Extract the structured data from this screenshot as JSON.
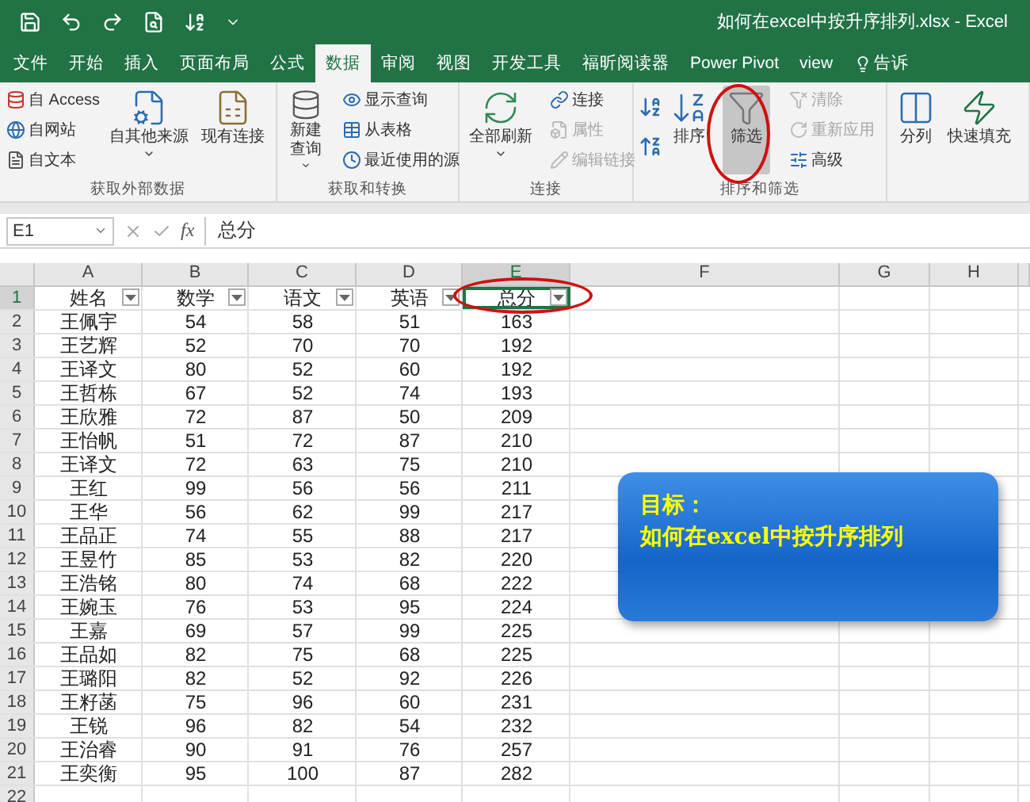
{
  "title_bar": {
    "title": "如何在excel中按升序排列.xlsx  -  Excel"
  },
  "tabs": [
    {
      "label": "文件",
      "selected": false
    },
    {
      "label": "开始",
      "selected": false
    },
    {
      "label": "插入",
      "selected": false
    },
    {
      "label": "页面布局",
      "selected": false
    },
    {
      "label": "公式",
      "selected": false
    },
    {
      "label": "数据",
      "selected": true
    },
    {
      "label": "审阅",
      "selected": false
    },
    {
      "label": "视图",
      "selected": false
    },
    {
      "label": "开发工具",
      "selected": false
    },
    {
      "label": "福昕阅读器",
      "selected": false
    },
    {
      "label": "Power Pivot",
      "selected": false
    },
    {
      "label": "view",
      "selected": false
    },
    {
      "label": "告诉",
      "selected": false
    }
  ],
  "ribbon": {
    "groups": [
      {
        "label": "获取外部数据",
        "items": [
          {
            "kind": "stack",
            "items": [
              {
                "label": "自 Access",
                "disabled": false
              },
              {
                "label": "自网站",
                "disabled": false
              },
              {
                "label": "自文本",
                "disabled": false
              }
            ]
          },
          {
            "kind": "large",
            "lines": [
              "自其他来源"
            ],
            "dropdown": true,
            "pressed": false
          },
          {
            "kind": "large",
            "lines": [
              "现有连接"
            ],
            "dropdown": false,
            "pressed": false
          }
        ]
      },
      {
        "label": "获取和转换",
        "items": [
          {
            "kind": "large",
            "lines": [
              "新建",
              "查询"
            ],
            "dropdown": true,
            "pressed": false
          },
          {
            "kind": "stack",
            "items": [
              {
                "label": "显示查询",
                "disabled": false
              },
              {
                "label": "从表格",
                "disabled": false
              },
              {
                "label": "最近使用的源",
                "disabled": false
              }
            ]
          }
        ]
      },
      {
        "label": "连接",
        "items": [
          {
            "kind": "large",
            "lines": [
              "全部刷新"
            ],
            "dropdown": true,
            "pressed": false
          },
          {
            "kind": "stack",
            "items": [
              {
                "label": "连接",
                "disabled": false
              },
              {
                "label": "属性",
                "disabled": true
              },
              {
                "label": "编辑链接",
                "disabled": true
              }
            ]
          }
        ]
      },
      {
        "label": "排序和筛选",
        "items": [
          {
            "kind": "sort-icons"
          },
          {
            "kind": "large",
            "lines": [
              "排序"
            ],
            "dropdown": false,
            "pressed": false
          },
          {
            "kind": "large",
            "lines": [
              "筛选"
            ],
            "dropdown": false,
            "pressed": true
          },
          {
            "kind": "stack",
            "items": [
              {
                "label": "清除",
                "disabled": true
              },
              {
                "label": "重新应用",
                "disabled": true
              },
              {
                "label": "高级",
                "disabled": false
              }
            ]
          }
        ]
      },
      {
        "items": [
          {
            "kind": "large",
            "lines": [
              "分列"
            ],
            "dropdown": false,
            "pressed": false
          },
          {
            "kind": "large",
            "lines": [
              "快速填充"
            ],
            "dropdown": false,
            "pressed": false
          }
        ]
      }
    ]
  },
  "formula_bar": {
    "name_box": "E1",
    "function_label": "fx",
    "formula": "总分"
  },
  "sheet": {
    "columns": [
      {
        "label": "A",
        "selected": false
      },
      {
        "label": "B",
        "selected": false
      },
      {
        "label": "C",
        "selected": false
      },
      {
        "label": "D",
        "selected": false
      },
      {
        "label": "E",
        "selected": true
      },
      {
        "label": "F",
        "selected": false
      },
      {
        "label": "G",
        "selected": false
      },
      {
        "label": "H",
        "selected": false
      }
    ],
    "header_row": {
      "number": "1",
      "selected": true,
      "cells": [
        "姓名",
        "数学",
        "语文",
        "英语",
        "总分"
      ]
    },
    "rows": [
      {
        "number": "2",
        "selected": false,
        "cells": [
          "王佩宇",
          "54",
          "58",
          "51",
          "163"
        ]
      },
      {
        "number": "3",
        "selected": false,
        "cells": [
          "王艺辉",
          "52",
          "70",
          "70",
          "192"
        ]
      },
      {
        "number": "4",
        "selected": false,
        "cells": [
          "王译文",
          "80",
          "52",
          "60",
          "192"
        ]
      },
      {
        "number": "5",
        "selected": false,
        "cells": [
          "王哲栋",
          "67",
          "52",
          "74",
          "193"
        ]
      },
      {
        "number": "6",
        "selected": false,
        "cells": [
          "王欣雅",
          "72",
          "87",
          "50",
          "209"
        ]
      },
      {
        "number": "7",
        "selected": false,
        "cells": [
          "王怡帆",
          "51",
          "72",
          "87",
          "210"
        ]
      },
      {
        "number": "8",
        "selected": false,
        "cells": [
          "王译文",
          "72",
          "63",
          "75",
          "210"
        ]
      },
      {
        "number": "9",
        "selected": false,
        "cells": [
          "王红",
          "99",
          "56",
          "56",
          "211"
        ]
      },
      {
        "number": "10",
        "selected": false,
        "cells": [
          "王华",
          "56",
          "62",
          "99",
          "217"
        ]
      },
      {
        "number": "11",
        "selected": false,
        "cells": [
          "王品正",
          "74",
          "55",
          "88",
          "217"
        ]
      },
      {
        "number": "12",
        "selected": false,
        "cells": [
          "王昱竹",
          "85",
          "53",
          "82",
          "220"
        ]
      },
      {
        "number": "13",
        "selected": false,
        "cells": [
          "王浩铭",
          "80",
          "74",
          "68",
          "222"
        ]
      },
      {
        "number": "14",
        "selected": false,
        "cells": [
          "王婉玉",
          "76",
          "53",
          "95",
          "224"
        ]
      },
      {
        "number": "15",
        "selected": false,
        "cells": [
          "王嘉",
          "69",
          "57",
          "99",
          "225"
        ]
      },
      {
        "number": "16",
        "selected": false,
        "cells": [
          "王品如",
          "82",
          "75",
          "68",
          "225"
        ]
      },
      {
        "number": "17",
        "selected": false,
        "cells": [
          "王璐阳",
          "82",
          "52",
          "92",
          "226"
        ]
      },
      {
        "number": "18",
        "selected": false,
        "cells": [
          "王籽菡",
          "75",
          "96",
          "60",
          "231"
        ]
      },
      {
        "number": "19",
        "selected": false,
        "cells": [
          "王锐",
          "96",
          "82",
          "54",
          "232"
        ]
      },
      {
        "number": "20",
        "selected": false,
        "cells": [
          "王治睿",
          "90",
          "91",
          "76",
          "257"
        ]
      },
      {
        "number": "21",
        "selected": false,
        "cells": [
          "王奕衡",
          "95",
          "100",
          "87",
          "282"
        ]
      },
      {
        "number": "22",
        "selected": false,
        "cells": []
      }
    ]
  },
  "callout": {
    "heading": "目标：",
    "text": "如何在excel中按升序排列"
  }
}
